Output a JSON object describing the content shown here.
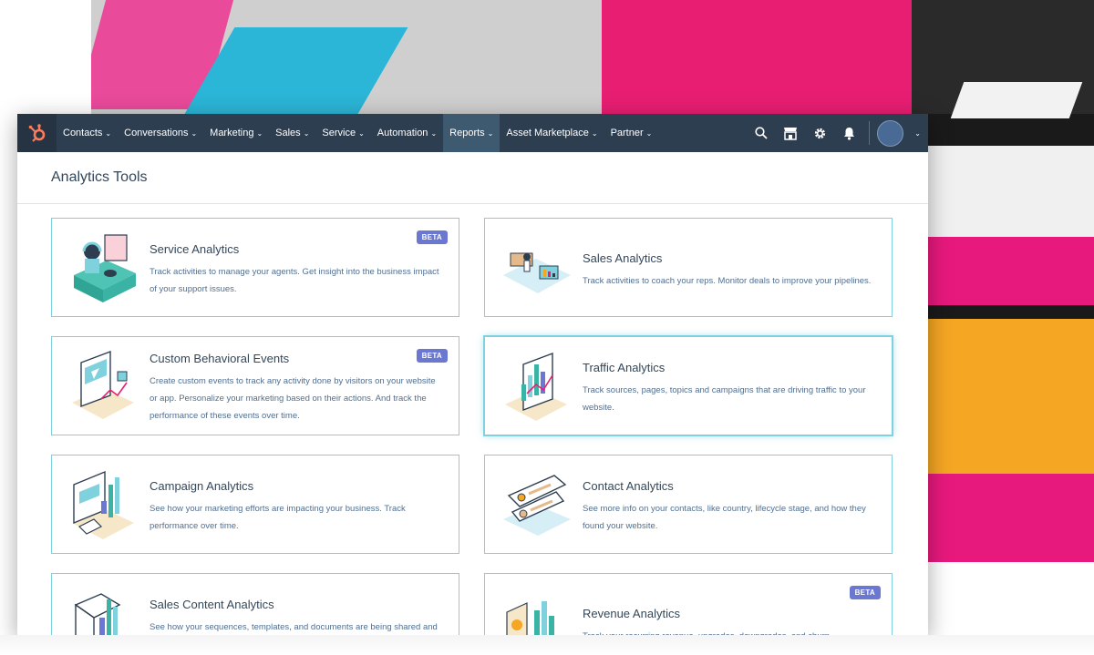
{
  "nav": {
    "items": [
      {
        "label": "Contacts"
      },
      {
        "label": "Conversations"
      },
      {
        "label": "Marketing"
      },
      {
        "label": "Sales"
      },
      {
        "label": "Service"
      },
      {
        "label": "Automation"
      },
      {
        "label": "Reports"
      },
      {
        "label": "Asset Marketplace"
      },
      {
        "label": "Partner"
      }
    ],
    "caret": "⌄"
  },
  "page": {
    "title": "Analytics Tools"
  },
  "cards": [
    {
      "title": "Service Analytics",
      "desc": "Track activities to manage your agents. Get insight into the business impact of your support issues.",
      "badge": "BETA"
    },
    {
      "title": "Sales Analytics",
      "desc": "Track activities to coach your reps. Monitor deals to improve your pipelines."
    },
    {
      "title": "Custom Behavioral Events",
      "desc": "Create custom events to track any activity done by visitors on your website or app. Personalize your marketing based on their actions. And track the performance of these events over time.",
      "badge": "BETA"
    },
    {
      "title": "Traffic Analytics",
      "desc": "Track sources, pages, topics and campaigns that are driving traffic to your website."
    },
    {
      "title": "Campaign Analytics",
      "desc": "See how your marketing efforts are impacting your business. Track performance over time."
    },
    {
      "title": "Contact Analytics",
      "desc": "See more info on your contacts, like country, lifecycle stage, and how they found your website."
    },
    {
      "title": "Sales Content Analytics",
      "desc": "See how your sequences, templates, and documents are being shared and"
    },
    {
      "title": "Revenue Analytics",
      "desc": "Track your recurring revenue, upgrades, downgrades, and churn.",
      "badge": "BETA"
    }
  ],
  "colors": {
    "nav_bg": "#2d3e50",
    "accent": "#ff7a59",
    "card_border": "#7fd1de",
    "beta": "#6a78d1"
  }
}
